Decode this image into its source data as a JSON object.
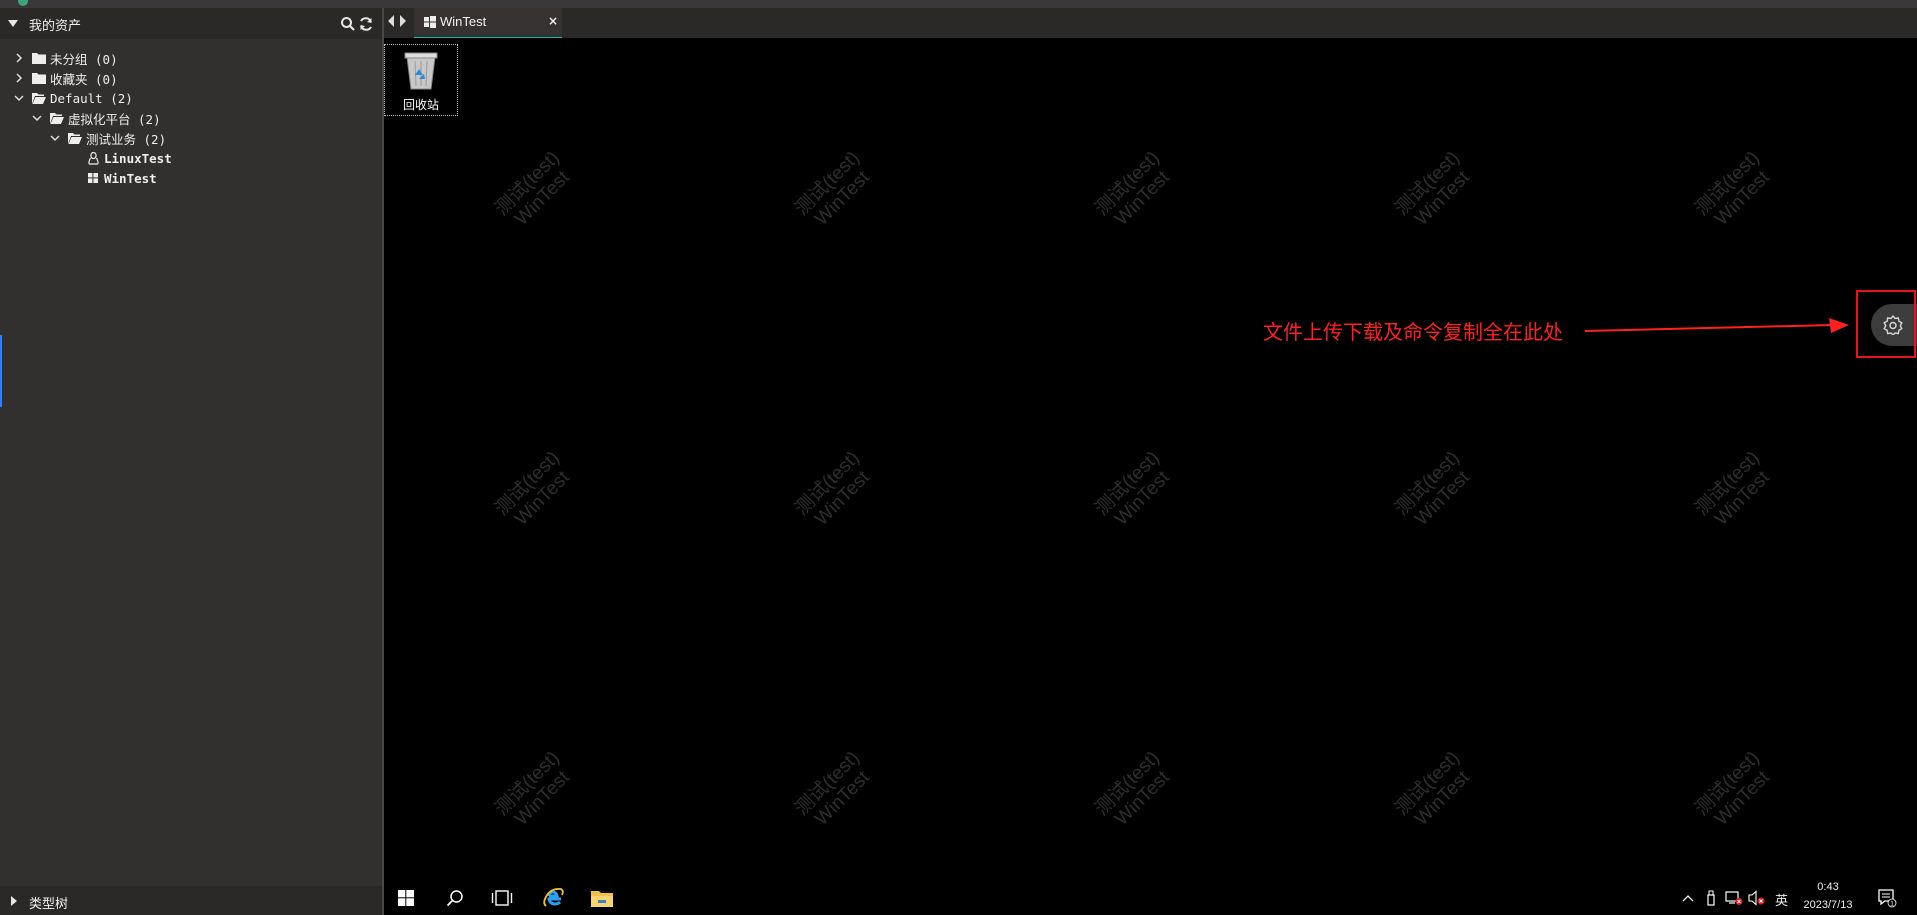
{
  "sidebar": {
    "header_title": "我的资产",
    "footer_title": "类型树",
    "tree": [
      {
        "label": "未分组 (0)",
        "kind": "folder"
      },
      {
        "label": "收藏夹 (0)",
        "kind": "folder"
      },
      {
        "label": "Default (2)",
        "kind": "folder-open"
      },
      {
        "label": "虚拟化平台 (2)",
        "kind": "folder-open"
      },
      {
        "label": "测试业务 (2)",
        "kind": "folder-open"
      },
      {
        "label": "LinuxTest",
        "kind": "linux"
      },
      {
        "label": "WinTest",
        "kind": "windows"
      }
    ]
  },
  "tabs": [
    {
      "label": "WinTest",
      "close": "×"
    }
  ],
  "desktop": {
    "recycle_bin_label": "回收站",
    "watermark_line1": "测试(test)",
    "watermark_line2": "WinTest"
  },
  "annotation": {
    "text": "文件上传下载及命令复制全在此处",
    "color": "#ff2020"
  },
  "taskbar": {
    "ime": "英",
    "time": "0:43",
    "date": "2023/7/13",
    "notification_count": "1"
  },
  "colors": {
    "accent_tab": "#20b6b0",
    "sidebar_bg": "#322f2f",
    "highlight_box": "#e8141a"
  }
}
